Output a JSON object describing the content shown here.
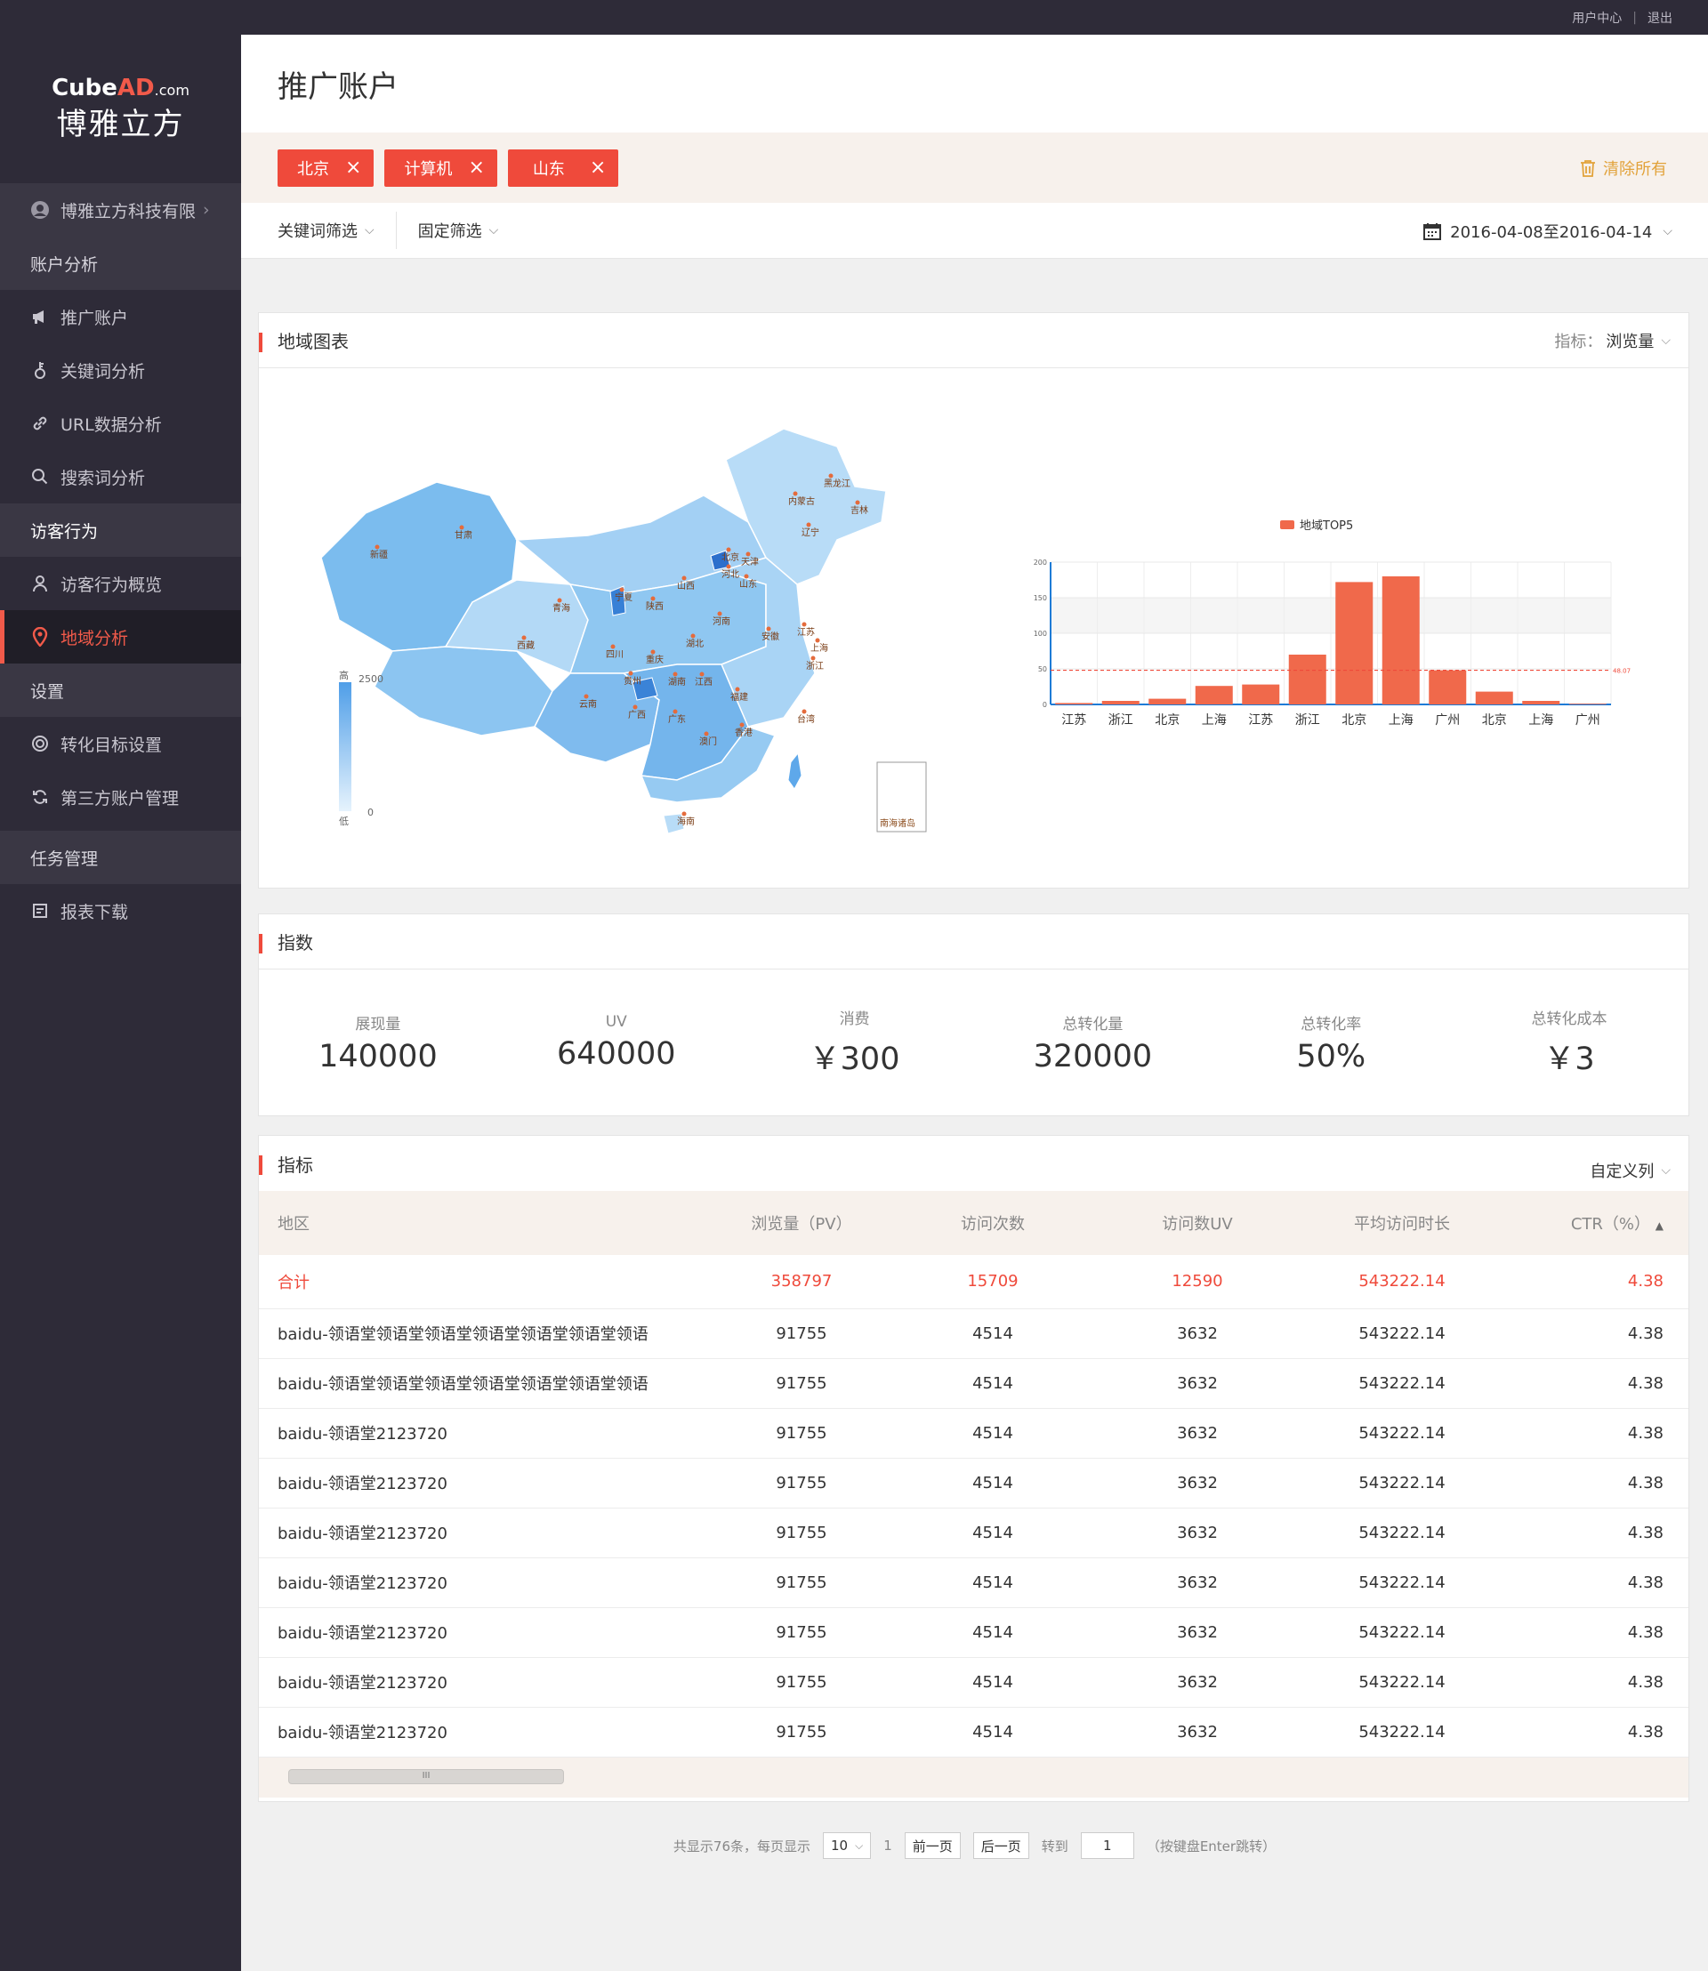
{
  "topbar": {
    "user_center": "用户中心",
    "sep": "|",
    "logout": "退出"
  },
  "logo": {
    "brand_cube": "Cube",
    "brand_ad": "AD",
    "brand_com": ".com",
    "brand_cn": "博雅立方"
  },
  "sidebar": {
    "company": "博雅立方科技有限",
    "groups": {
      "account_analysis": "账户分析",
      "visitor_behavior": "访客行为",
      "settings": "设置",
      "task_mgmt": "任务管理"
    },
    "items": {
      "promo_account": "推广账户",
      "keyword_analysis": "关键词分析",
      "url_analysis": "URL数据分析",
      "search_term_analysis": "搜索词分析",
      "visitor_overview": "访客行为概览",
      "region_analysis": "地域分析",
      "conversion_goal": "转化目标设置",
      "third_party": "第三方账户管理",
      "report_download": "报表下载"
    }
  },
  "page": {
    "title": "推广账户"
  },
  "tags": [
    "北京",
    "计算机",
    "山东"
  ],
  "clear_all": "清除所有",
  "filters": {
    "keyword": "关键词筛选",
    "fixed": "固定筛选",
    "date_range": "2016-04-08至2016-04-14"
  },
  "map_card": {
    "title": "地域图表",
    "metric_label": "指标：",
    "metric_value": "浏览量",
    "legend_high": "高",
    "legend_low": "低",
    "legend_max": "2500",
    "legend_min": "0",
    "south_sea": "南海诸岛",
    "provinces": [
      "黑龙江",
      "吉林",
      "辽宁",
      "内蒙古",
      "新疆",
      "甘肃",
      "北京",
      "天津",
      "河北",
      "山西",
      "山东",
      "宁夏",
      "陕西",
      "青海",
      "河南",
      "江苏",
      "安徽",
      "上海",
      "湖北",
      "西藏",
      "四川",
      "重庆",
      "浙江",
      "贵州",
      "湖南",
      "江西",
      "福建",
      "云南",
      "广西",
      "广东",
      "台湾",
      "澳门",
      "香港",
      "海南"
    ]
  },
  "chart_data": {
    "type": "bar",
    "legend": "地域TOP5",
    "categories": [
      "江苏",
      "浙江",
      "北京",
      "上海",
      "江苏",
      "浙江",
      "北京",
      "上海",
      "广州",
      "北京",
      "上海",
      "广州"
    ],
    "values": [
      2,
      5,
      8,
      26,
      28,
      70,
      172,
      180,
      48,
      18,
      5,
      1
    ],
    "ylim": [
      0,
      200
    ],
    "yticks": [
      0,
      50,
      100,
      150,
      200
    ],
    "average_line": 48.07,
    "average_label": "48.07",
    "colors": {
      "bar": "#f0694b",
      "avg": "#ef4a3b"
    }
  },
  "kpi_card": {
    "title": "指数",
    "items": [
      {
        "label": "展现量",
        "value": "140000"
      },
      {
        "label": "UV",
        "value": "640000"
      },
      {
        "label": "消费",
        "value": "￥300"
      },
      {
        "label": "总转化量",
        "value": "320000"
      },
      {
        "label": "总转化率",
        "value": "50%"
      },
      {
        "label": "总转化成本",
        "value": "￥3"
      }
    ]
  },
  "table_card": {
    "title": "指标",
    "custom_cols": "自定义列",
    "columns": [
      "地区",
      "浏览量（PV）",
      "访问次数",
      "访问数UV",
      "平均访问时长",
      "CTR（%）"
    ],
    "total": [
      "合计",
      "358797",
      "15709",
      "12590",
      "543222.14",
      "4.38"
    ],
    "rows": [
      [
        "baidu-领语堂领语堂领语堂领语堂领语堂领语堂领语",
        "91755",
        "4514",
        "3632",
        "543222.14",
        "4.38"
      ],
      [
        "baidu-领语堂领语堂领语堂领语堂领语堂领语堂领语",
        "91755",
        "4514",
        "3632",
        "543222.14",
        "4.38"
      ],
      [
        "baidu-领语堂2123720",
        "91755",
        "4514",
        "3632",
        "543222.14",
        "4.38"
      ],
      [
        "baidu-领语堂2123720",
        "91755",
        "4514",
        "3632",
        "543222.14",
        "4.38"
      ],
      [
        "baidu-领语堂2123720",
        "91755",
        "4514",
        "3632",
        "543222.14",
        "4.38"
      ],
      [
        "baidu-领语堂2123720",
        "91755",
        "4514",
        "3632",
        "543222.14",
        "4.38"
      ],
      [
        "baidu-领语堂2123720",
        "91755",
        "4514",
        "3632",
        "543222.14",
        "4.38"
      ],
      [
        "baidu-领语堂2123720",
        "91755",
        "4514",
        "3632",
        "543222.14",
        "4.38"
      ],
      [
        "baidu-领语堂2123720",
        "91755",
        "4514",
        "3632",
        "543222.14",
        "4.38"
      ]
    ],
    "scroll_thumb": "III"
  },
  "pager": {
    "summary": "共显示76条，每页显示",
    "page_size": "10",
    "current_page": "1",
    "prev": "前一页",
    "next": "后一页",
    "goto": "转到",
    "goto_value": "1",
    "hint": "（按键盘Enter跳转）"
  }
}
